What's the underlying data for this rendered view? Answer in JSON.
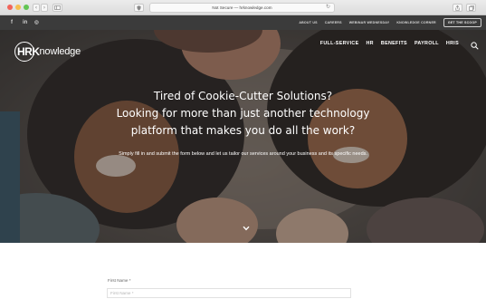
{
  "browser": {
    "address_text": "Not Secure — hrknowledge.com",
    "reload_glyph": "↻",
    "back_glyph": "‹",
    "forward_glyph": "›"
  },
  "topbar": {
    "social": {
      "facebook": "f",
      "linkedin": "in",
      "instagram": "◎"
    },
    "links": [
      "ABOUT US",
      "CAREERS",
      "WEBINAR WEDNESDAY",
      "KNOWLEDGE CORNER"
    ],
    "tour_button": "GET THE SCOOP"
  },
  "header": {
    "logo_hrk": "HRK",
    "logo_rest": "nowledge",
    "nav": [
      "FULL-SERVICE",
      "HR",
      "BENEFITS",
      "PAYROLL",
      "HRIS"
    ]
  },
  "hero": {
    "headline_lines": [
      "Tired of Cookie-Cutter Solutions?",
      "Looking for more than just another technology",
      "platform that makes you do all the work?"
    ],
    "subline": "Simply fill in and submit the form below and let us tailor our services around your business and its specific needs."
  },
  "form": {
    "first_name_label": "First Name *",
    "first_name_placeholder": "First Name *"
  },
  "colors": {
    "topbar_bg": "#3b3b3b",
    "hero_overlay": "rgba(30,28,32,0.38)",
    "text_light": "#ffffff"
  }
}
